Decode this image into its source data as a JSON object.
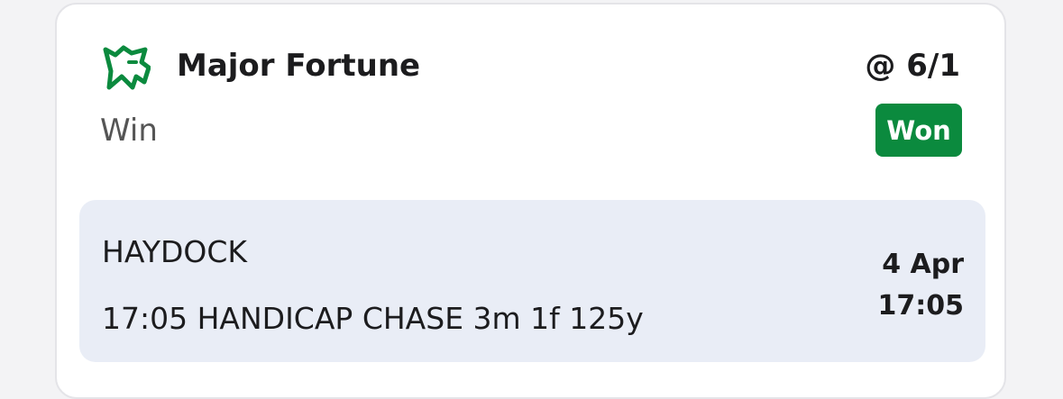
{
  "bet": {
    "selection": "Major Fortune",
    "odds": "@ 6/1",
    "market": "Win",
    "status": "Won",
    "icon": "horse-icon"
  },
  "event": {
    "venue": "HAYDOCK",
    "race": "17:05 HANDICAP CHASE 3m 1f 125y",
    "date": "4 Apr",
    "time": "17:05"
  },
  "colors": {
    "status_won": "#0b8a3e",
    "icon_green": "#0b8a3e",
    "event_background": "#e9edf6"
  }
}
